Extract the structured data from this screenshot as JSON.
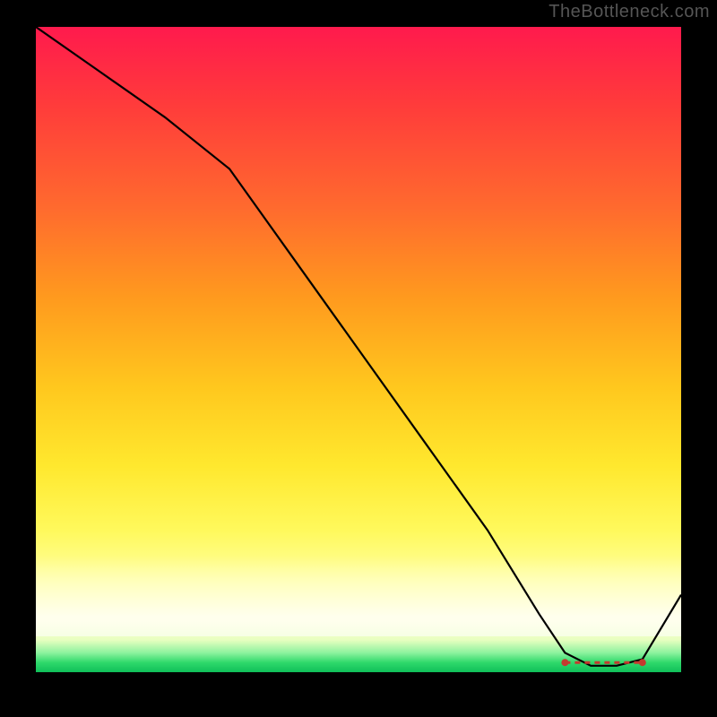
{
  "watermark": "TheBottleneck.com",
  "chart_data": {
    "type": "line",
    "title": "",
    "xlabel": "",
    "ylabel": "",
    "xlim": [
      0,
      100
    ],
    "ylim": [
      0,
      100
    ],
    "series": [
      {
        "name": "curve",
        "x": [
          0,
          10,
          20,
          30,
          40,
          50,
          60,
          70,
          78,
          82,
          86,
          90,
          94,
          100
        ],
        "values": [
          100,
          93,
          86,
          78,
          64,
          50,
          36,
          22,
          9,
          3,
          1,
          1,
          2,
          12
        ]
      }
    ],
    "flat_zone": {
      "x_start": 82,
      "x_end": 94,
      "y": 1.5
    },
    "flat_zone_label": ""
  }
}
